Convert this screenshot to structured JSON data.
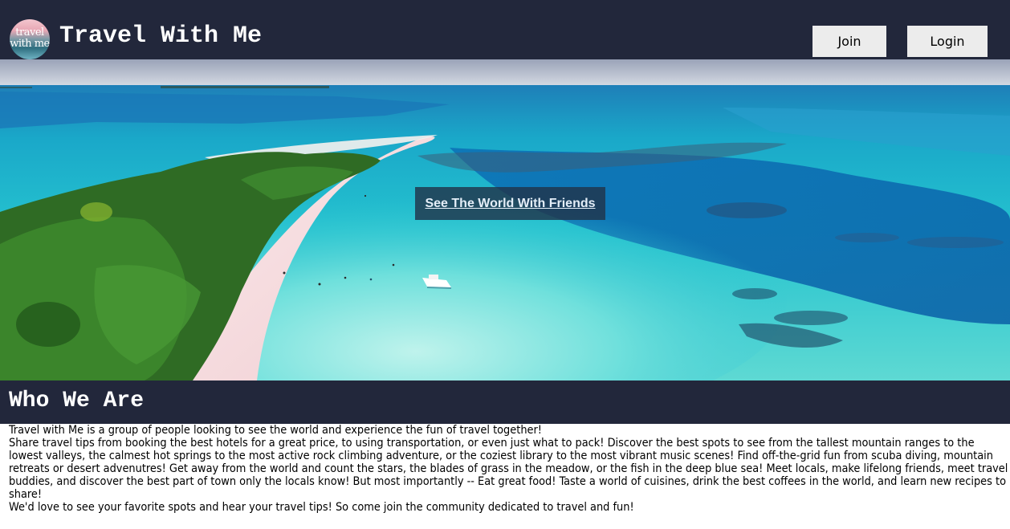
{
  "header": {
    "logo_text": [
      "travel",
      "with me"
    ],
    "title": "Travel With Me",
    "join_label": "Join",
    "login_label": "Login"
  },
  "hero": {
    "cta_label": "See The World With Friends",
    "image_subject": "aerial tropical island with turquoise lagoon and white sand spit"
  },
  "about": {
    "title": "Who We Are",
    "paragraphs": [
      "Travel with Me is a group of people looking to see the world and experience the fun of travel together!",
      "Share travel tips from booking the best hotels for a great price, to using transportation, or even just what to pack! Discover the best spots to see from the tallest mountain ranges to the lowest valleys, the calmest hot springs to the most active rock climbing adventure, or the coziest library to the most vibrant music scenes! Find off-the-grid fun from scuba diving, mountain retreats or desert advenutres! Get away from the world and count the stars, the blades of grass in the meadow, or the fish in the deep blue sea! Meet locals, make lifelong friends, meet travel buddies, and discover the best part of town only the locals know! But most importantly -- Eat great food! Taste a world of cuisines, drink the best coffees in the world, and learn new recipes to share!",
      "We'd love to see your favorite spots and hear your travel tips! So come join the community dedicated to travel and fun!"
    ]
  },
  "colors": {
    "header_bg": "#22273b",
    "button_bg": "#ececec",
    "cta_bg": "#21354a",
    "text": "#000000"
  }
}
